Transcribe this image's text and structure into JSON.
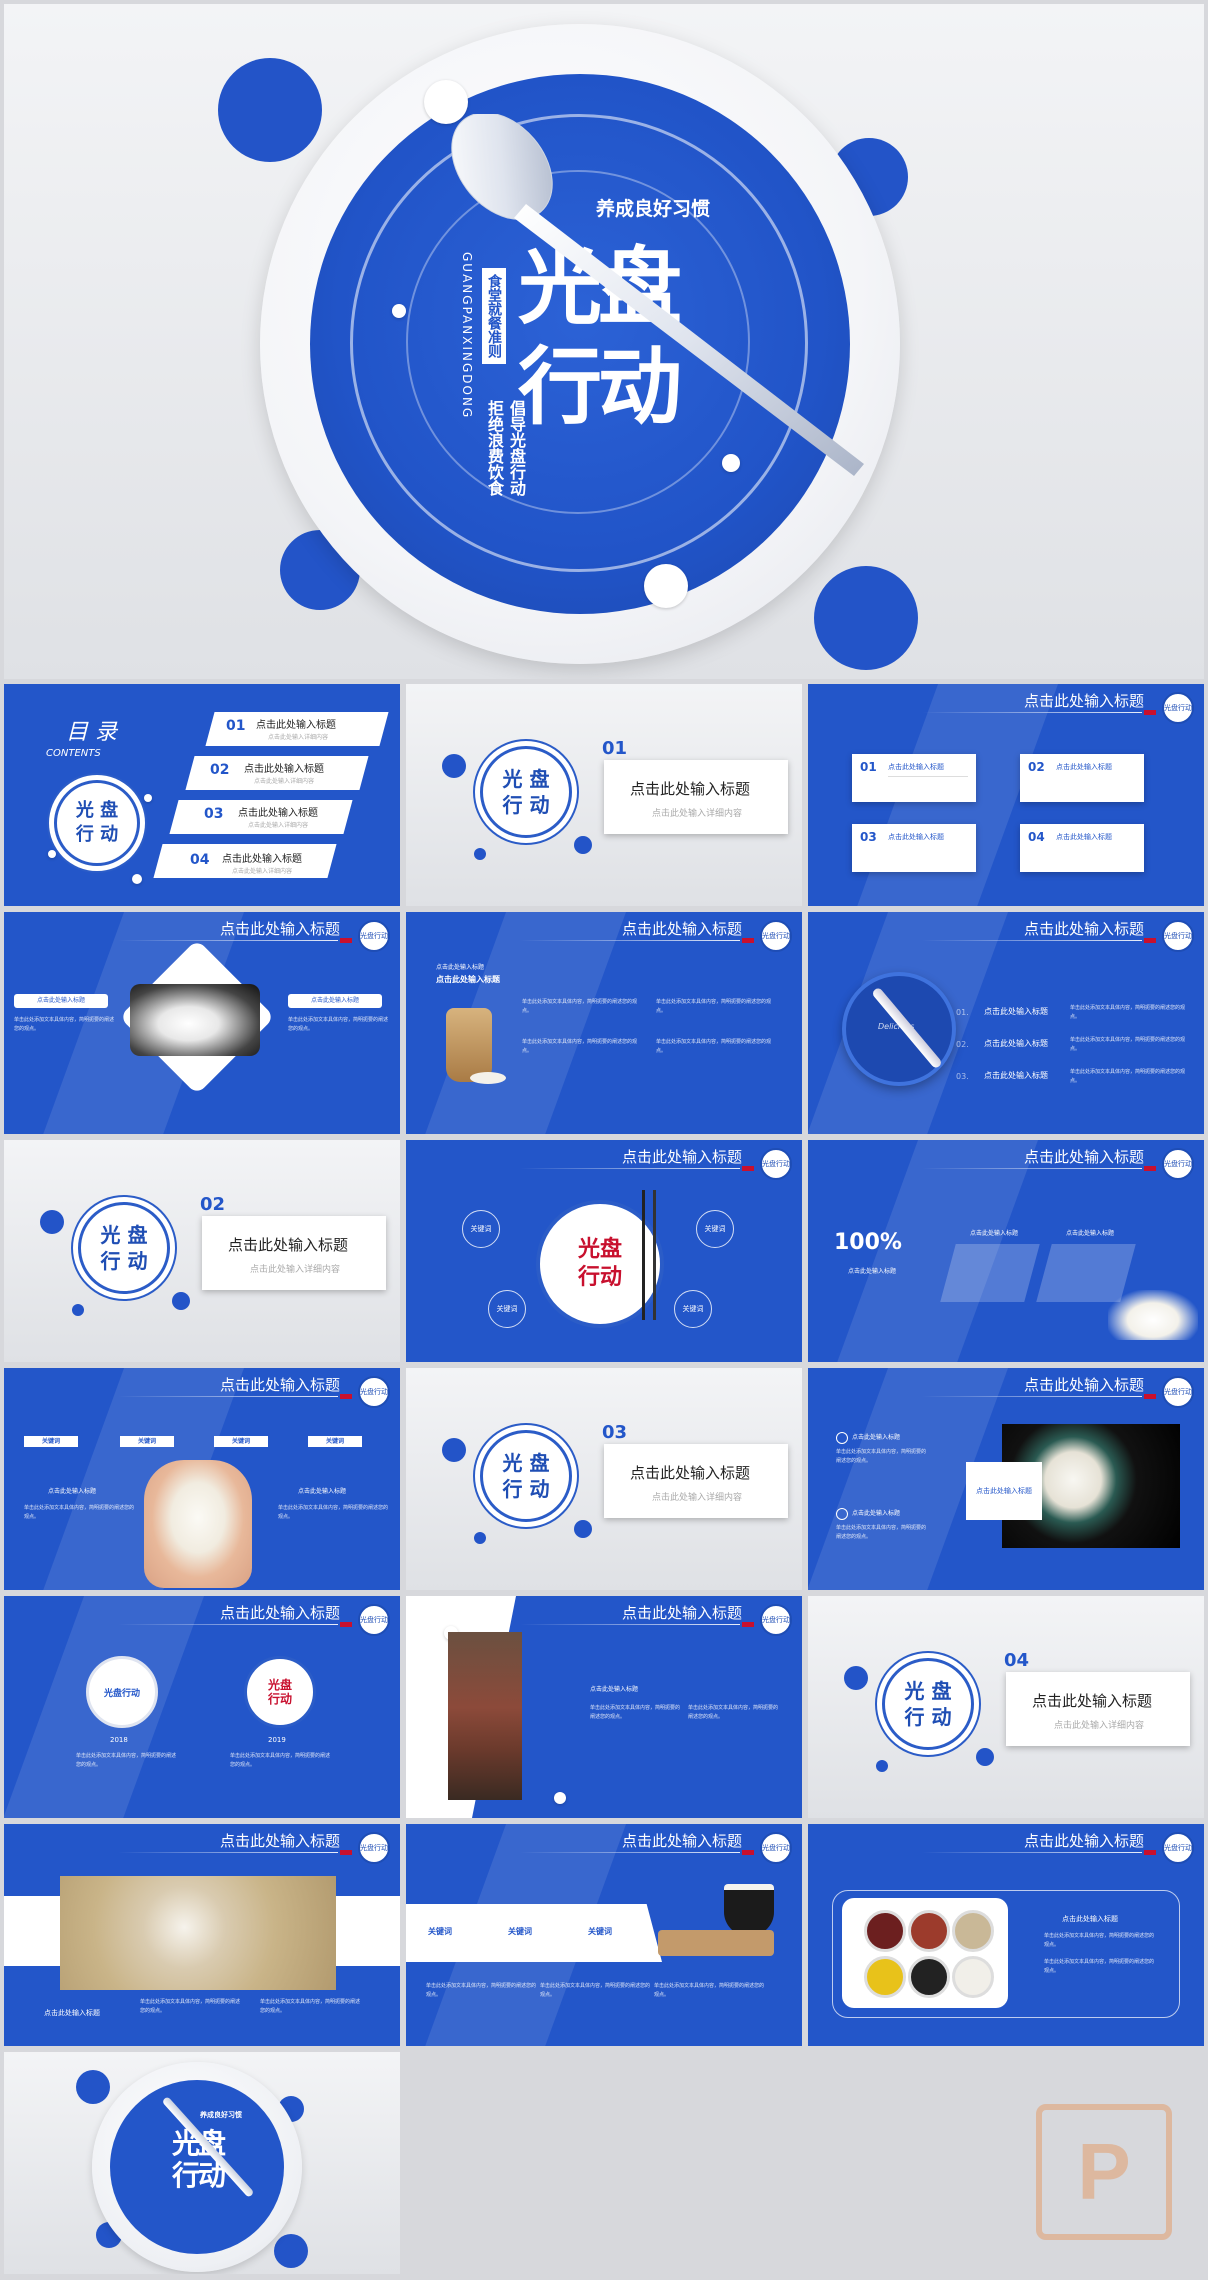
{
  "cover": {
    "tagline": "养成良好习惯",
    "title_line1": "光盘",
    "title_line2": "行动",
    "pinyin": "GUANGPANXINGDONG",
    "vertical_1": "食堂就餐准则",
    "vertical_2": "拒绝浪费饮食",
    "vertical_3": "倡导光盘行动"
  },
  "toc": {
    "title": "目 录",
    "subtitle": "CONTENTS",
    "medal_text": "光 盘 行 动",
    "items": [
      {
        "num": "01",
        "label": "点击此处输入标题",
        "sub": "点击此处输入详细内容"
      },
      {
        "num": "02",
        "label": "点击此处输入标题",
        "sub": "点击此处输入详细内容"
      },
      {
        "num": "03",
        "label": "点击此处输入标题",
        "sub": "点击此处输入详细内容"
      },
      {
        "num": "04",
        "label": "点击此处输入标题",
        "sub": "点击此处输入详细内容"
      }
    ]
  },
  "common": {
    "slide_title": "点击此处输入标题",
    "section_title": "点击此处输入标题",
    "section_sub": "点击此处输入详细内容",
    "seal": "光盘行动",
    "keyword": "关键词",
    "input_label": "点击此处输入标题",
    "body": "单击此处添加文本具体内容，简明扼要的阐述您的观点。"
  },
  "sections": [
    "01",
    "02",
    "03",
    "04"
  ],
  "slide3": {
    "items": [
      {
        "num": "01",
        "label": "点击此处输入标题"
      },
      {
        "num": "02",
        "label": "点击此处输入标题"
      },
      {
        "num": "03",
        "label": "点击此处输入标题"
      },
      {
        "num": "04",
        "label": "点击此处输入标题"
      }
    ]
  },
  "slide6": {
    "nums": [
      "01.",
      "02.",
      "03."
    ],
    "plate_text": "Delicious"
  },
  "slide8": {
    "emblem": "光盘 行动"
  },
  "slide9": {
    "percent": "100%"
  },
  "slide14": {
    "years": [
      "2018",
      "2019"
    ],
    "plate_left": "光盘行动",
    "plate_right": "光盘 行动"
  },
  "closing": {
    "tagline": "养成良好习惯",
    "title": "光盘行动"
  },
  "watermark": {
    "letter": "P"
  },
  "colors": {
    "primary": "#2356c9",
    "accent": "#c8102e",
    "light": "#ffffff"
  }
}
